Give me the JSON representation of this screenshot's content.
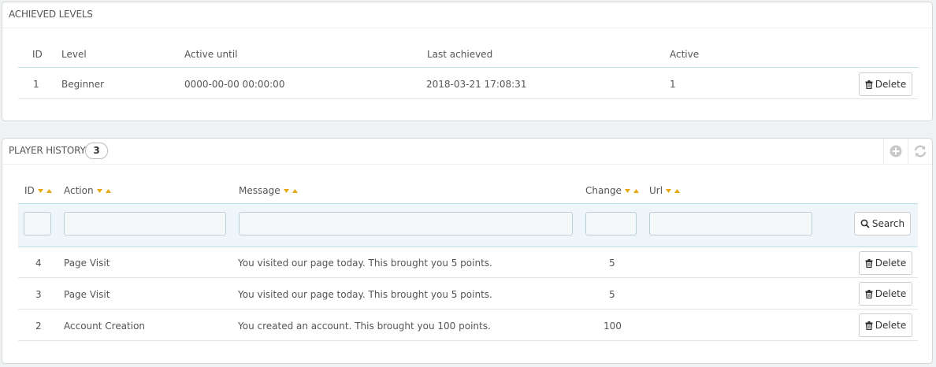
{
  "achieved_levels": {
    "title": "ACHIEVED LEVELS",
    "columns": [
      "ID",
      "Level",
      "Active until",
      "Last achieved",
      "Active"
    ],
    "rows": [
      {
        "id": "1",
        "level": "Beginner",
        "active_until": "0000-00-00 00:00:00",
        "last_achieved": "2018-03-21 17:08:31",
        "active": "1",
        "action": "Delete"
      }
    ]
  },
  "player_history": {
    "title": "PLAYER HISTORY",
    "count": "3",
    "columns": [
      "ID",
      "Action",
      "Message",
      "Change",
      "Url"
    ],
    "filter": {
      "id": "",
      "action": "",
      "message": "",
      "change": "",
      "url": "",
      "search_label": "Search"
    },
    "rows": [
      {
        "id": "4",
        "action": "Page Visit",
        "message": "You visited our page today. This brought you 5 points.",
        "change": "5",
        "url": "",
        "delete_label": "Delete"
      },
      {
        "id": "3",
        "action": "Page Visit",
        "message": "You visited our page today. This brought you 5 points.",
        "change": "5",
        "url": "",
        "delete_label": "Delete"
      },
      {
        "id": "2",
        "action": "Account Creation",
        "message": "You created an account. This brought you 100 points.",
        "change": "100",
        "url": "",
        "delete_label": "Delete"
      }
    ],
    "toolbar": {
      "add_icon": "plus-circle-icon",
      "refresh_icon": "refresh-icon"
    }
  },
  "colors": {
    "sort_arrow": "#e7a50e",
    "header_line": "#bcdde9",
    "filter_bg": "#eef6fb"
  }
}
